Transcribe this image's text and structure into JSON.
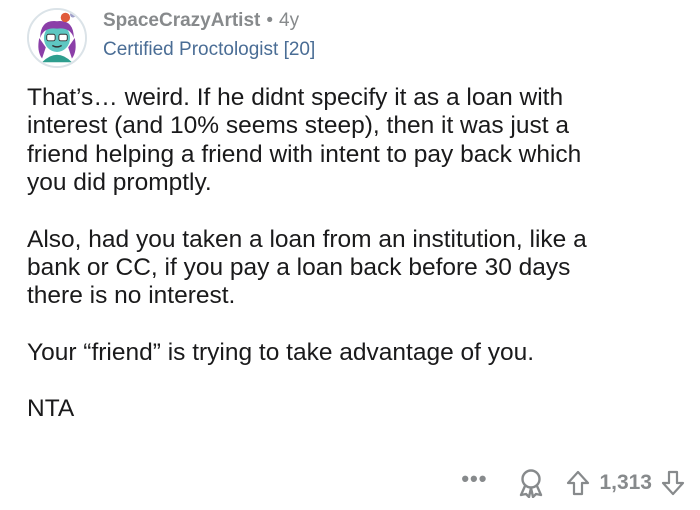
{
  "comment": {
    "username": "SpaceCrazyArtist",
    "separator": "•",
    "age": "4y",
    "flair": "Certified Proctologist [20]",
    "paragraphs": [
      "That’s… weird. If he didnt specify it as a loan with\ninterest (and 10% seems steep), then it was just a\nfriend helping a friend with intent to pay back which\nyou did promptly.",
      "Also, had you taken a loan from an institution, like a\nbank or CC, if you pay a loan back before 30 days\nthere is no interest.",
      "Your “friend” is trying to take advantage of you.",
      "NTA"
    ],
    "actions": {
      "more_label": "•••",
      "score": "1,313",
      "icons": [
        "avatar",
        "more-icon",
        "award-icon",
        "upvote-icon",
        "downvote-icon"
      ]
    }
  }
}
